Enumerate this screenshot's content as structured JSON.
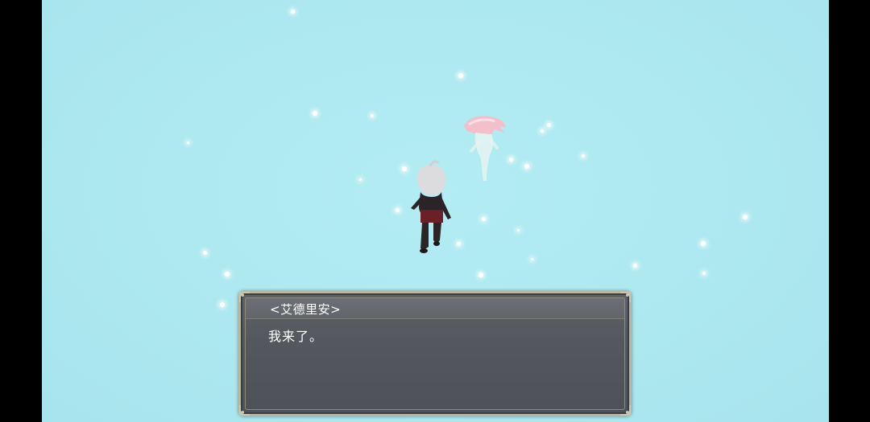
{
  "dialog": {
    "speaker": "<艾德里安>",
    "message": "我来了。"
  },
  "scene": {
    "background": "#ade8f0",
    "characters": [
      "white-haired-boy",
      "pink-haired-spirit"
    ]
  }
}
